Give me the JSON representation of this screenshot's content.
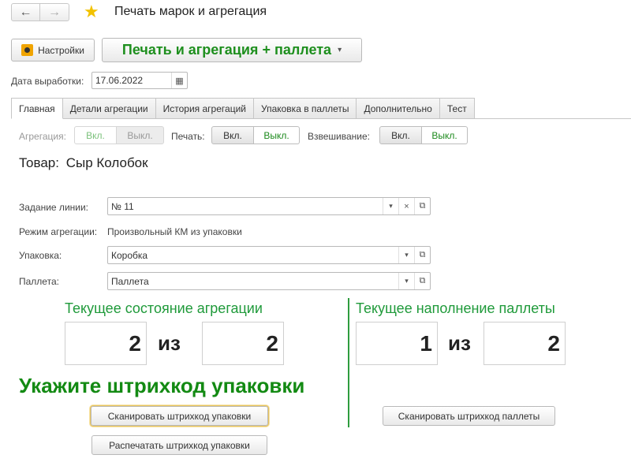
{
  "window": {
    "title": "Печать марок и агрегация",
    "back_icon": "←",
    "forward_icon": "→",
    "favorite_icon": "★"
  },
  "toolbar": {
    "settings_label": "Настройки",
    "mode_label": "Печать и агрегация + паллета",
    "mode_caret": "▾"
  },
  "date": {
    "label": "Дата выработки:",
    "value": "17.06.2022",
    "calendar_icon": "▦"
  },
  "tabs": [
    {
      "label": "Главная",
      "active": true
    },
    {
      "label": "Детали агрегации"
    },
    {
      "label": "История агрегаций"
    },
    {
      "label": "Упаковка в паллеты"
    },
    {
      "label": "Дополнительно"
    },
    {
      "label": "Тест"
    }
  ],
  "toggles": {
    "aggregation": {
      "label": "Агрегация:",
      "on": "Вкл.",
      "off": "Выкл."
    },
    "print": {
      "label": "Печать:",
      "on": "Вкл.",
      "off": "Выкл."
    },
    "weighing": {
      "label": "Взвешивание:",
      "on": "Вкл.",
      "off": "Выкл."
    }
  },
  "product": {
    "label": "Товар:",
    "name": "Сыр Колобок"
  },
  "form": {
    "line_task": {
      "label": "Задание линии:",
      "value": "№ 11"
    },
    "aggregation_mode": {
      "label": "Режим агрегации:",
      "value": "Произвольный КМ из упаковки"
    },
    "package": {
      "label": "Упаковка:",
      "value": "Коробка"
    },
    "pallet": {
      "label": "Паллета:",
      "value": "Паллета"
    },
    "dropdown_icon": "▾",
    "clear_icon": "×",
    "open_icon": "⧉"
  },
  "aggregation_state": {
    "title": "Текущее состояние агрегации",
    "current": "2",
    "of_label": "из",
    "total": "2"
  },
  "pallet_state": {
    "title": "Текущее наполнение паллеты",
    "current": "1",
    "of_label": "из",
    "total": "2"
  },
  "prompt": "Укажите штрихкод упаковки",
  "buttons": {
    "scan_package": "Сканировать штрихкод упаковки",
    "print_package": "Распечатать штрихкод упаковки",
    "scan_pallet": "Сканировать штрихкод паллеты"
  }
}
